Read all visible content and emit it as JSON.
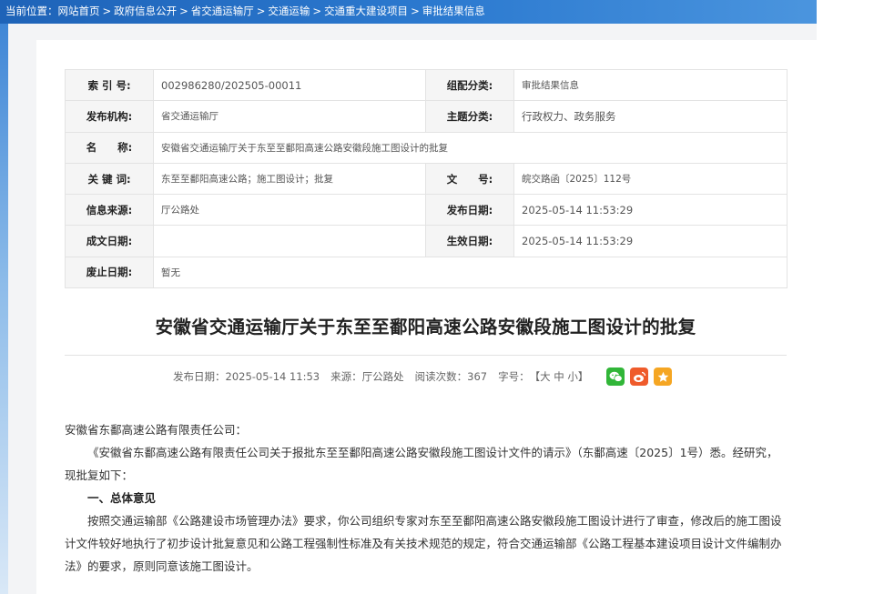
{
  "breadcrumb": {
    "prefix": "当前位置：",
    "items": [
      "网站首页",
      "政府信息公开",
      "省交通运输厅",
      "交通运输",
      "交通重大建设项目",
      "审批结果信息"
    ],
    "separator": ">"
  },
  "info_table": {
    "index_label": "索 引 号:",
    "index_value": "002986280/202505-00011",
    "category_label": "组配分类:",
    "category_value": "审批结果信息",
    "publisher_label": "发布机构:",
    "publisher_value": "省交通运输厅",
    "topic_label": "主题分类:",
    "topic_value": "行政权力、政务服务",
    "name_label": "名　　称:",
    "name_value": "安徽省交通运输厅关于东至至鄱阳高速公路安徽段施工图设计的批复",
    "keywords_label": "关 键 词:",
    "keywords_value": "东至至鄱阳高速公路；施工图设计；批复",
    "docno_label": "文　　号:",
    "docno_value": "皖交路函〔2025〕112号",
    "source_label": "信息来源:",
    "source_value": "厅公路处",
    "pubdate_label": "发布日期:",
    "pubdate_value": "2025-05-14 11:53:29",
    "created_label": "成文日期:",
    "created_value": "",
    "effective_label": "生效日期:",
    "effective_value": "2025-05-14 11:53:29",
    "expiry_label": "废止日期:",
    "expiry_value": "暂无"
  },
  "article": {
    "title": "安徽省交通运输厅关于东至至鄱阳高速公路安徽段施工图设计的批复",
    "meta_date": "发布日期：2025-05-14 11:53",
    "meta_source": "来源：厅公路处",
    "meta_reads": "阅读次数：367",
    "meta_fontsize_label": "字号：",
    "fontsize_open": "【",
    "fontsize_large": "大",
    "fontsize_medium": "中",
    "fontsize_small": "小",
    "fontsize_close": "】",
    "addressee": "安徽省东鄱高速公路有限责任公司：",
    "para1": "《安徽省东鄱高速公路有限责任公司关于报批东至至鄱阳高速公路安徽段施工图设计文件的请示》（东鄱高速〔2025〕1号）悉。经研究，现批复如下：",
    "heading1": "一、总体意见",
    "para2": "按照交通运输部《公路建设市场管理办法》要求，你公司组织专家对东至至鄱阳高速公路安徽段施工图设计进行了审查，修改后的施工图设计文件较好地执行了初步设计批复意见和公路工程强制性标准及有关技术规范的规定，符合交通运输部《公路工程基本建设项目设计文件编制办法》的要求，原则同意该施工图设计。"
  },
  "share_icons": [
    "wechat-icon",
    "weibo-icon",
    "favorite-star-icon"
  ],
  "colors": {
    "topbar": "#1e63b8",
    "wechat": "#31b638",
    "weibo": "#ef5b2b",
    "favorite": "#f5a623"
  }
}
